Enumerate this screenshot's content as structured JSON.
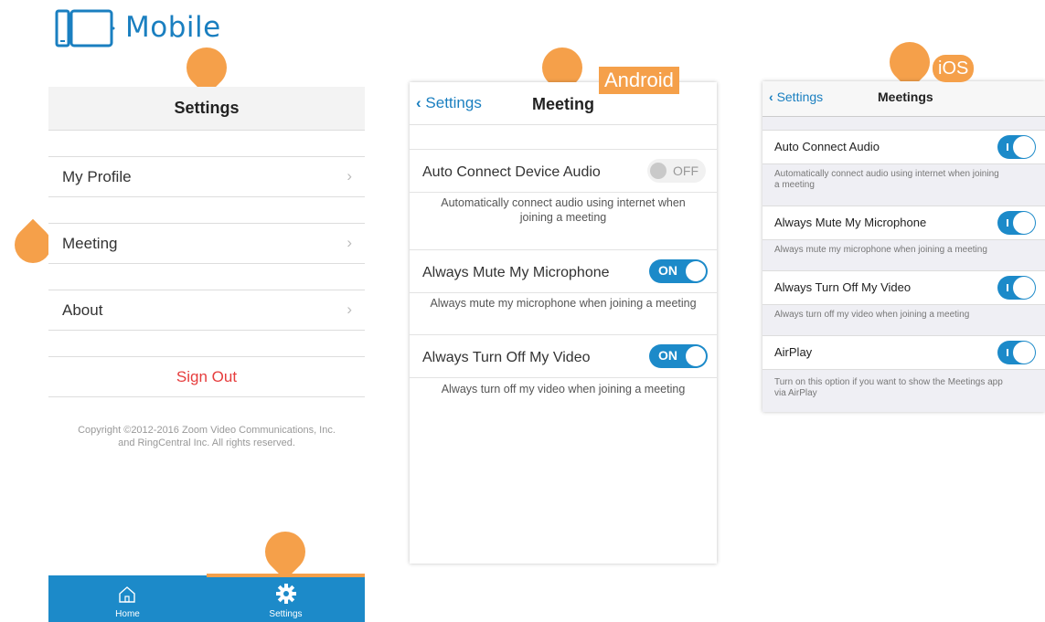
{
  "brand": {
    "title": "Mobile",
    "accent": "#1a7fc0",
    "marker_color": "#f5a04a"
  },
  "panel_settings": {
    "title": "Settings",
    "items": [
      {
        "label": "My Profile",
        "icon": "chevron-right-icon"
      },
      {
        "label": "Meeting",
        "icon": "chevron-right-icon"
      },
      {
        "label": "About",
        "icon": "chevron-right-icon"
      }
    ],
    "sign_out": "Sign Out",
    "copyright_line1": "Copyright ©2012-2016 Zoom Video Communications, Inc.",
    "copyright_line2": "and RingCentral Inc. All rights reserved.",
    "tabs": [
      {
        "label": "Home",
        "icon": "home-icon"
      },
      {
        "label": "Settings",
        "icon": "gear-icon"
      }
    ]
  },
  "panel_android": {
    "callout": "Android",
    "back_label": "Settings",
    "title": "Meeting",
    "rows": [
      {
        "label": "Auto Connect Device Audio",
        "state": "OFF",
        "desc_line1": "Automatically connect audio using internet when",
        "desc_line2": "joining a meeting"
      },
      {
        "label": "Always Mute My Microphone",
        "state": "ON",
        "desc_line1": "Always mute my microphone when joining a meeting",
        "desc_line2": ""
      },
      {
        "label": "Always Turn Off My Video",
        "state": "ON",
        "desc_line1": "Always turn off my video when joining a meeting",
        "desc_line2": ""
      }
    ]
  },
  "panel_ios": {
    "callout": "iOS",
    "back_label": "Settings",
    "title": "Meetings",
    "rows": [
      {
        "label": "Auto Connect Audio",
        "on": true,
        "desc_line1": "Automatically connect audio using internet when joining",
        "desc_line2": "a meeting"
      },
      {
        "label": "Always Mute My Microphone",
        "on": true,
        "desc_line1": "Always mute my microphone when joining a meeting",
        "desc_line2": ""
      },
      {
        "label": "Always Turn Off My Video",
        "on": true,
        "desc_line1": "Always turn off my video when joining a meeting",
        "desc_line2": ""
      },
      {
        "label": "AirPlay",
        "on": true,
        "desc_line1": "Turn on this option if you want to show the Meetings app",
        "desc_line2": "via AirPlay"
      }
    ]
  }
}
